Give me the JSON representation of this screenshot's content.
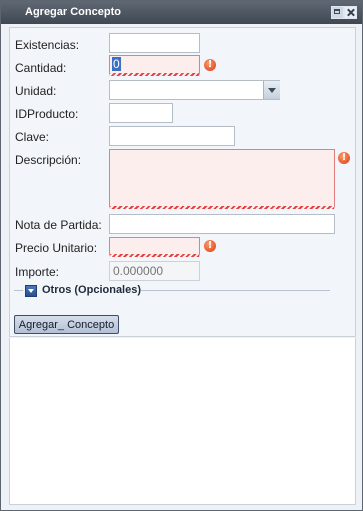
{
  "window": {
    "title": "Agregar Concepto",
    "accent": "#4a545f",
    "invalid_color": "#e34141"
  },
  "form": {
    "existencias": {
      "label": "Existencias:",
      "value": ""
    },
    "cantidad": {
      "label": "Cantidad:",
      "value": "0"
    },
    "unidad": {
      "label": "Unidad:",
      "value": ""
    },
    "idproducto": {
      "label": "IDProducto:",
      "value": ""
    },
    "clave": {
      "label": "Clave:",
      "value": ""
    },
    "descripcion": {
      "label": "Descripción:",
      "value": ""
    },
    "nota_partida": {
      "label": "Nota de Partida:",
      "value": ""
    },
    "precio_unitario": {
      "label": "Precio Unitario:",
      "value": ""
    },
    "importe": {
      "label": "Importe:",
      "placeholder": "0.000000"
    }
  },
  "optional_section": {
    "legend": "Otros (Opcionales)"
  },
  "actions": {
    "add_label": "Agregar_ Concepto"
  },
  "icons": {
    "error": "exclamation-icon",
    "combo": "chevron-down-icon",
    "maximize": "maximize-icon",
    "close": "close-icon",
    "collapse": "collapse-toggle-icon"
  }
}
